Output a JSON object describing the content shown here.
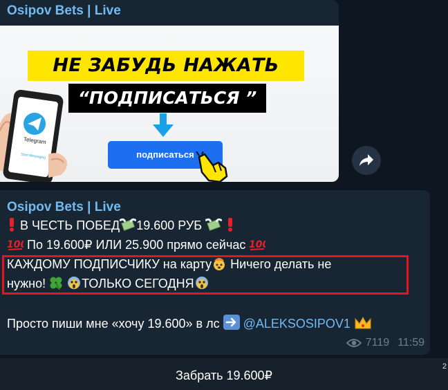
{
  "post1": {
    "channel_name": "Osipov Bets | Live",
    "promo": {
      "headline": "НЕ ЗАБУДЬ НАЖАТЬ",
      "subhead": "“ПОДПИСАТЬСЯ ”",
      "button_label": "подписаться",
      "app_label": "Telegram",
      "app_small_label": "Start Messaging"
    }
  },
  "post2": {
    "channel_name": "Osipov Bets | Live",
    "line1": "В ЧЕСТЬ ПОБЕД",
    "line1b": "19.600 РУБ",
    "line2": "По 19.600₽ ИЛИ 25.900 прямо сейчас",
    "line3a": "КАЖДОМУ ПОДПИСЧИКУ на карту",
    "line3b": "Ничего делать не",
    "line4a": "нужно!",
    "line4b": "ТОЛЬКО СЕГОДНЯ",
    "line5a": "Просто пиши мне «хочу 19.600» в лс",
    "handle": "@ALEKSOSIPOV1",
    "views": "7119",
    "time": "11:59"
  },
  "bottom_button": "Забрать 19.600₽",
  "scroll_indicator": "2",
  "icons": {
    "share": "share-arrow-icon",
    "eye": "eye-icon",
    "exclamation": "red-exclamation-icon",
    "money": "money-with-wings-icon",
    "hundred": "hundred-points-icon",
    "exploding_head": "exploding-head-icon",
    "clover": "four-leaf-clover-icon",
    "scream": "face-screaming-icon",
    "right_arrow": "right-arrow-icon",
    "crown": "crown-icon"
  },
  "colors": {
    "background": "#0e1621",
    "bubble": "#182533",
    "channel_name": "#71baf2",
    "highlight_border": "#e8141b",
    "promo_yellow": "#ffe600",
    "promo_button": "#1e6ff0"
  }
}
